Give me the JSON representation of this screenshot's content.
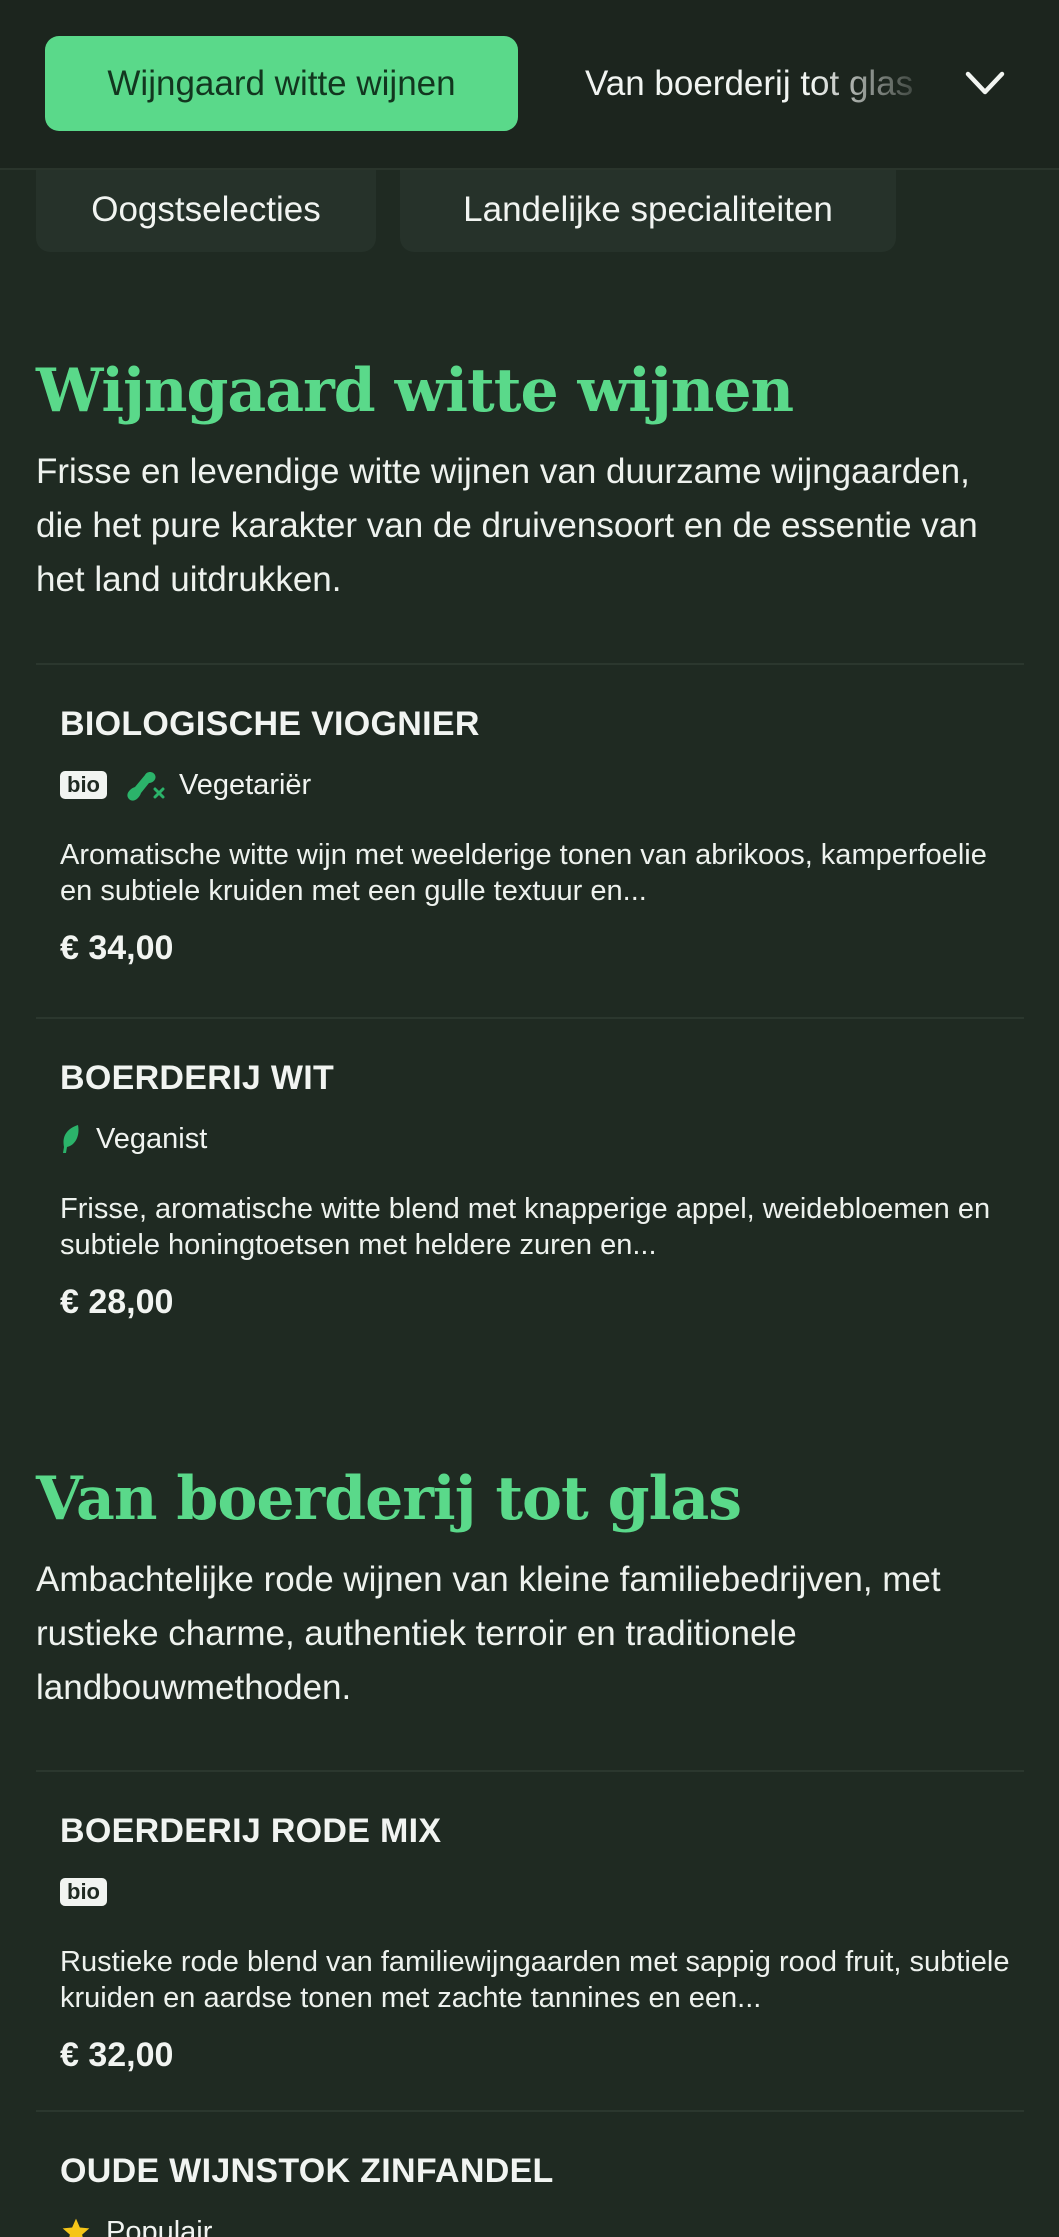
{
  "nav": {
    "active_tab": "Wijngaard witte wijnen",
    "next_tab": "Van boerderij tot glas",
    "sub_tabs": [
      "Oogstselecties",
      "Landelijke specialiteiten"
    ]
  },
  "sections": [
    {
      "title": "Wijngaard witte wijnen",
      "description": "Frisse en levendige witte wijnen van duurzame wijngaarden, die het pure karakter van de druivensoort en de essentie van het land uitdrukken.",
      "items": [
        {
          "name": "BIOLOGISCHE VIOGNIER",
          "badges": {
            "bio": "bio",
            "diet": "Vegetariër"
          },
          "description": "Aromatische witte wijn met weelderige tonen van abrikoos, kamperfoelie en subtiele kruiden met een gulle textuur en...",
          "price": "€ 34,00"
        },
        {
          "name": "BOERDERIJ WIT",
          "badges": {
            "diet": "Veganist"
          },
          "description": "Frisse, aromatische witte blend met knapperige appel, weidebloemen en subtiele honingtoetsen met heldere zuren en...",
          "price": "€ 28,00"
        }
      ]
    },
    {
      "title": "Van boerderij tot glas",
      "description": "Ambachtelijke rode wijnen van kleine familiebedrijven, met rustieke charme, authentiek terroir en traditionele landbouwmethoden.",
      "items": [
        {
          "name": "BOERDERIJ RODE MIX",
          "badges": {
            "bio": "bio"
          },
          "description": "Rustieke rode blend van familiewijngaarden met sappig rood fruit, subtiele kruiden en aardse tonen met zachte tannines en een...",
          "price": "€ 32,00"
        },
        {
          "name": "OUDE WIJNSTOK ZINFANDEL",
          "badges": {
            "popular": "Populair"
          }
        }
      ]
    }
  ],
  "colors": {
    "accent": "#5ad98a",
    "background": "#1f2a22",
    "star": "#f5c518"
  },
  "icons": [
    "chevron-down-icon",
    "no-meat-icon",
    "leaf-icon",
    "star-icon"
  ]
}
